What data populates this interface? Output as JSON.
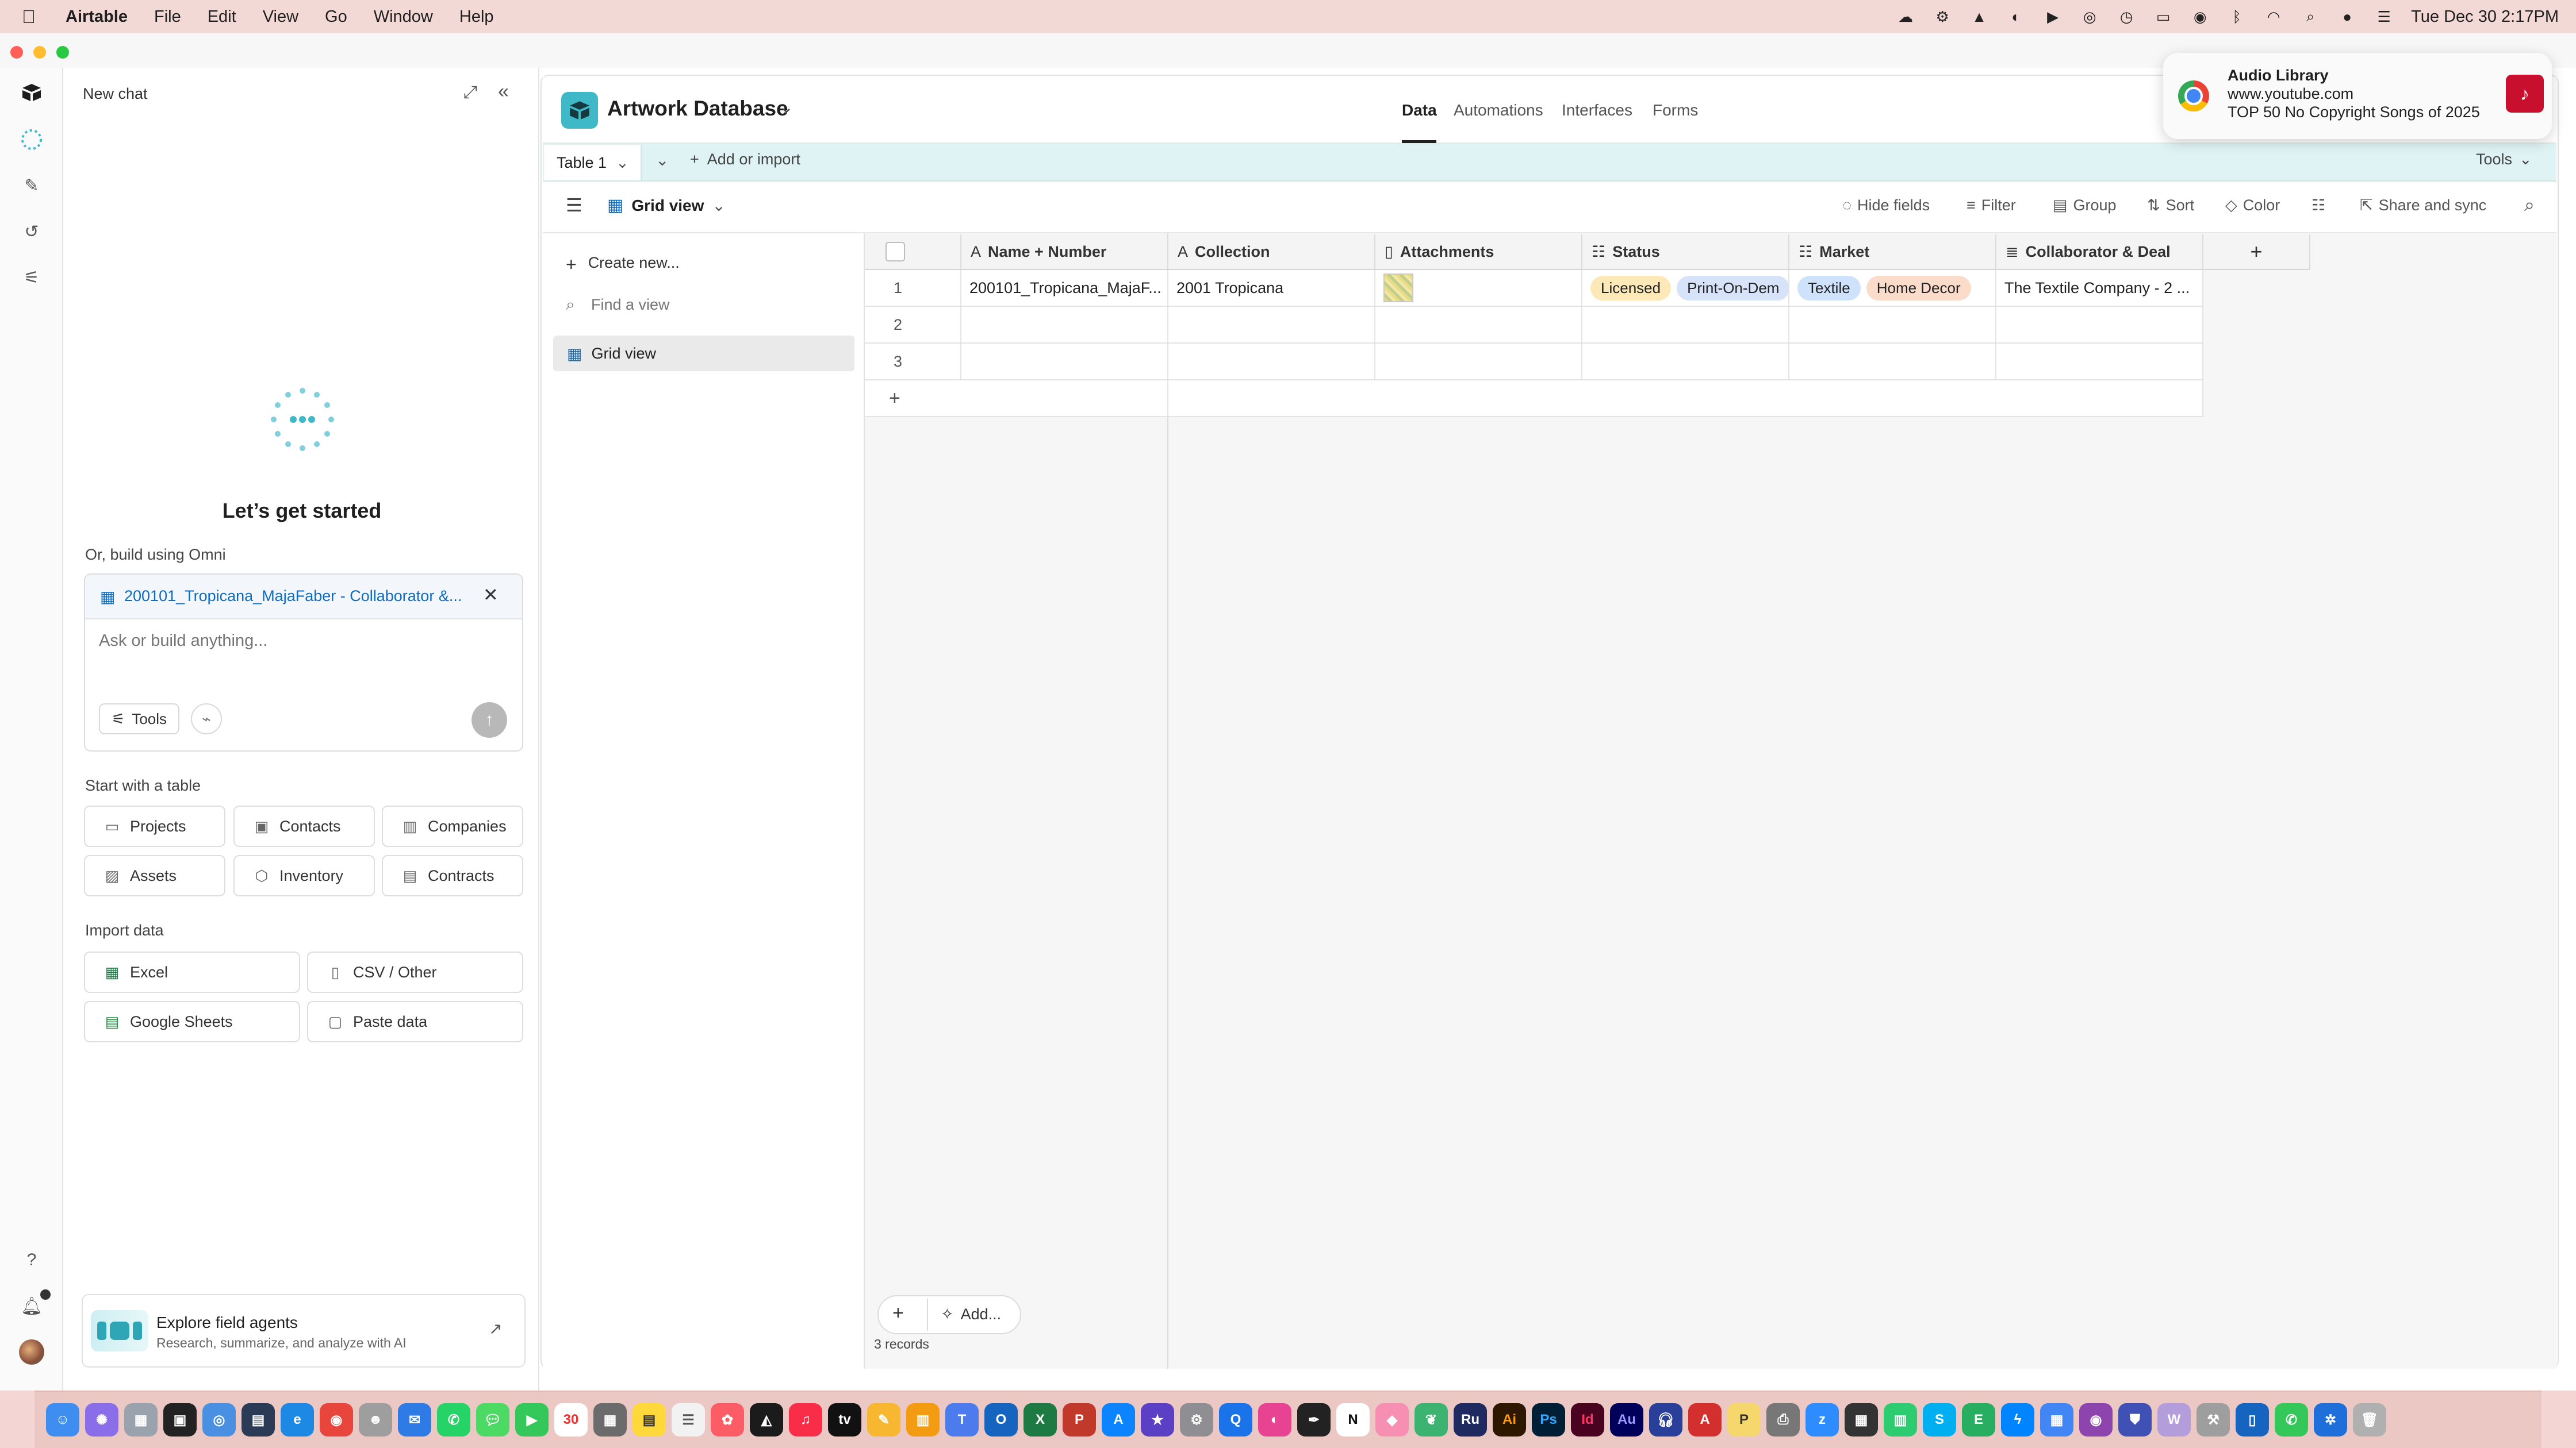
{
  "menubar": {
    "app": "Airtable",
    "items": [
      "File",
      "Edit",
      "View",
      "Go",
      "Window",
      "Help"
    ],
    "clock": "Tue Dec 30  2:17PM"
  },
  "chat": {
    "title": "New chat",
    "heading": "Let’s get started",
    "omni_label": "Or, build using Omni",
    "context_chip": "200101_Tropicana_MajaFaber - Collaborator &...",
    "placeholder": "Ask or build anything...",
    "tools_label": "Tools",
    "start_label": "Start with a table",
    "templates": [
      "Projects",
      "Contacts",
      "Companies",
      "Assets",
      "Inventory",
      "Contracts"
    ],
    "import_label": "Import data",
    "imports": [
      "Excel",
      "CSV / Other",
      "Google Sheets",
      "Paste data"
    ],
    "agents_title": "Explore field agents",
    "agents_sub": "Research, summarize, and analyze with AI"
  },
  "app": {
    "base_name": "Artwork Database",
    "tabs": [
      "Data",
      "Automations",
      "Interfaces",
      "Forms"
    ],
    "table_name": "Table 1",
    "add_import": "Add or import",
    "tools": "Tools",
    "view_name": "Grid view",
    "toolbar": [
      "Hide fields",
      "Filter",
      "Group",
      "Sort",
      "Color",
      "Share and sync"
    ],
    "sidebar": {
      "create": "Create new...",
      "find_placeholder": "Find a view",
      "view": "Grid view"
    }
  },
  "grid": {
    "columns": [
      "Name + Number",
      "Collection",
      "Attachments",
      "Status",
      "Market",
      "Collaborator & Deal"
    ],
    "rows": [
      {
        "num": "1",
        "name": "200101_Tropicana_MajaF...",
        "collection": "2001 Tropicana",
        "status": [
          "Licensed",
          "Print-On-Dem"
        ],
        "market": [
          "Textile",
          "Home Decor"
        ],
        "collab": "The Textile Company - 2 ..."
      },
      {
        "num": "2"
      },
      {
        "num": "3"
      }
    ],
    "add_label": "Add...",
    "record_count": "3 records"
  },
  "notification": {
    "title": "Audio Library",
    "url": "www.youtube.com",
    "body": "TOP 50 No Copyright Songs of 2025"
  },
  "colors": {
    "accent": "#0f6cbd",
    "teal": "#3fb8c7",
    "pill_licensed": "#fde9b8",
    "pill_pod": "#d7e3f8",
    "pill_textile": "#cfe2fb",
    "pill_homedecor": "#fbdccb"
  }
}
